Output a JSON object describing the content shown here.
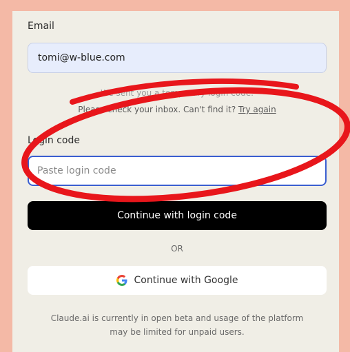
{
  "form": {
    "email_label": "Email",
    "email_value": "tomi@w-blue.com",
    "info_line1": "We sent you a temporary login code.",
    "info_line2_prefix": "Please check your inbox. Can't find it? ",
    "info_retry_link": "Try again",
    "code_label": "Login code",
    "code_placeholder": "Paste login code",
    "continue_code_button": "Continue with login code",
    "or_text": "OR",
    "google_button": "Continue with Google",
    "beta_note_line1": "Claude.ai is currently in open beta and usage of the platform",
    "beta_note_line2": "may be limited for unpaid users."
  },
  "colors": {
    "frame": "#f4b9a6",
    "panel": "#f0eee6",
    "primary_button": "#000000",
    "input_focus_border": "#3a5ed0",
    "annotation_ellipse": "#e8161b"
  },
  "icons": {
    "google": "google-g-icon"
  }
}
